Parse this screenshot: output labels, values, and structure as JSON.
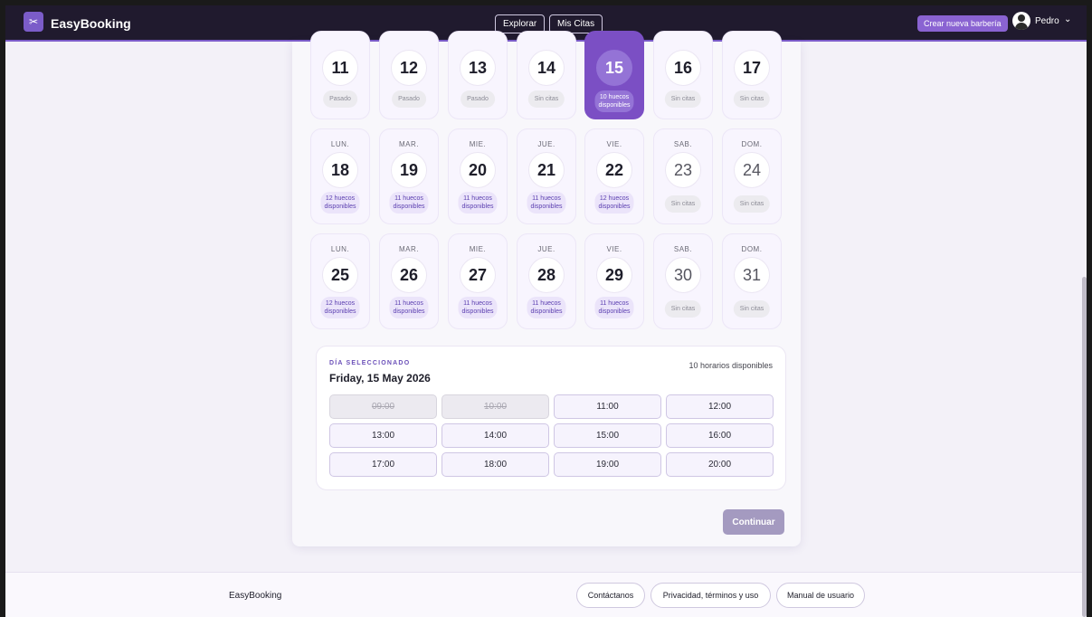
{
  "navbar": {
    "brand": "EasyBooking",
    "explore_label": "Explorar",
    "appointments_label": "Mis Citas",
    "create_label": "Crear nueva barbería",
    "user_name": "Pedro"
  },
  "calendar": {
    "rows": [
      {
        "days": [
          {
            "abbr": "",
            "num": "11",
            "pill": "Pasado",
            "kind": "none"
          },
          {
            "abbr": "",
            "num": "12",
            "pill": "Pasado",
            "kind": "none"
          },
          {
            "abbr": "",
            "num": "13",
            "pill": "Pasado",
            "kind": "none"
          },
          {
            "abbr": "",
            "num": "14",
            "pill": "Sin citas",
            "kind": "none"
          },
          {
            "abbr": "",
            "num": "15",
            "pill": "10 huecos\ndisponibles",
            "kind": "selected"
          },
          {
            "abbr": "",
            "num": "16",
            "pill": "Sin citas",
            "kind": "none"
          },
          {
            "abbr": "",
            "num": "17",
            "pill": "Sin citas",
            "kind": "none"
          }
        ]
      },
      {
        "days": [
          {
            "abbr": "LUN.",
            "num": "18",
            "pill": "12 huecos\ndisponibles",
            "kind": "avail"
          },
          {
            "abbr": "MAR.",
            "num": "19",
            "pill": "11 huecos\ndisponibles",
            "kind": "avail"
          },
          {
            "abbr": "MIE.",
            "num": "20",
            "pill": "11 huecos\ndisponibles",
            "kind": "avail"
          },
          {
            "abbr": "JUE.",
            "num": "21",
            "pill": "11 huecos\ndisponibles",
            "kind": "avail"
          },
          {
            "abbr": "VIE.",
            "num": "22",
            "pill": "12 huecos\ndisponibles",
            "kind": "avail"
          },
          {
            "abbr": "SAB.",
            "num": "23",
            "pill": "Sin citas",
            "kind": "none"
          },
          {
            "abbr": "DOM.",
            "num": "24",
            "pill": "Sin citas",
            "kind": "none"
          }
        ]
      },
      {
        "days": [
          {
            "abbr": "LUN.",
            "num": "25",
            "pill": "12 huecos\ndisponibles",
            "kind": "avail"
          },
          {
            "abbr": "MAR.",
            "num": "26",
            "pill": "11 huecos\ndisponibles",
            "kind": "avail"
          },
          {
            "abbr": "MIE.",
            "num": "27",
            "pill": "11 huecos\ndisponibles",
            "kind": "avail"
          },
          {
            "abbr": "JUE.",
            "num": "28",
            "pill": "11 huecos\ndisponibles",
            "kind": "avail"
          },
          {
            "abbr": "VIE.",
            "num": "29",
            "pill": "11 huecos\ndisponibles",
            "kind": "avail"
          },
          {
            "abbr": "SAB.",
            "num": "30",
            "pill": "Sin citas",
            "kind": "none"
          },
          {
            "abbr": "DOM.",
            "num": "31",
            "pill": "Sin citas",
            "kind": "none"
          }
        ]
      }
    ]
  },
  "selected": {
    "label": "DÍA SELECCIONADO",
    "date": "Friday, 15 May 2026",
    "count": "10 horarios disponibles",
    "slots": [
      {
        "time": "09:00",
        "disabled": true
      },
      {
        "time": "10:00",
        "disabled": true
      },
      {
        "time": "11:00",
        "disabled": false
      },
      {
        "time": "12:00",
        "disabled": false
      },
      {
        "time": "13:00",
        "disabled": false
      },
      {
        "time": "14:00",
        "disabled": false
      },
      {
        "time": "15:00",
        "disabled": false
      },
      {
        "time": "16:00",
        "disabled": false
      },
      {
        "time": "17:00",
        "disabled": false
      },
      {
        "time": "18:00",
        "disabled": false
      },
      {
        "time": "19:00",
        "disabled": false
      },
      {
        "time": "20:00",
        "disabled": false
      }
    ]
  },
  "continue_label": "Continuar",
  "footer": {
    "brand": "EasyBooking",
    "contact_label": "Contáctanos",
    "privacy_label": "Privacidad, términos y uso",
    "manual_label": "Manual de usuario"
  },
  "icons": {
    "logo": "scissors-icon",
    "user": "user-avatar-icon",
    "dropdown": "chevron-down-icon"
  },
  "colors": {
    "accent": "#7b4fc4",
    "navbar": "#201a2e"
  }
}
